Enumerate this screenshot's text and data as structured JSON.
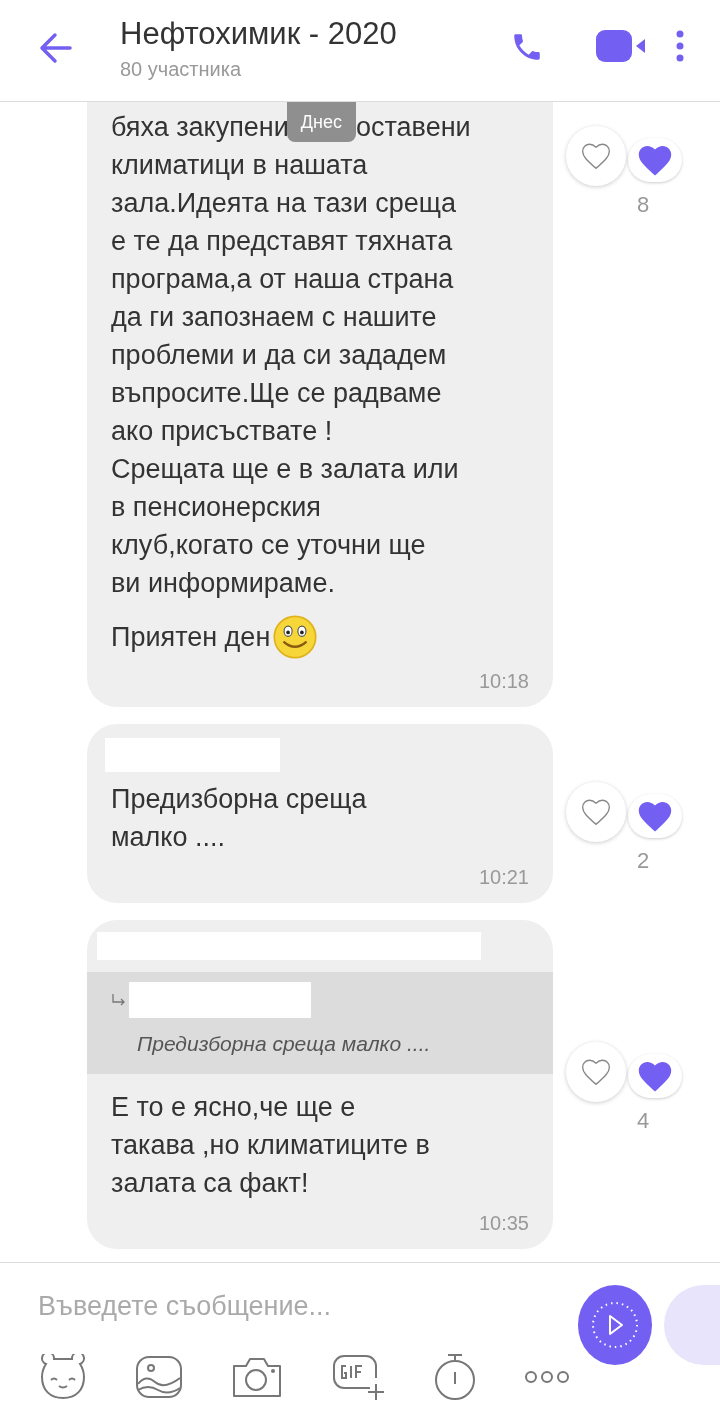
{
  "header": {
    "title": "Нефтохимик - 2020",
    "subtitle": "80 участника"
  },
  "date_badge": "Днес",
  "messages": [
    {
      "first_line": [
        "бяха закупени",
        "оставени"
      ],
      "text": "климатици в нашата\nзала.Идеята на тази среща\nе те да представят тяхната\nпрограма,а от наша страна\nда ги запознаем с нашите\nпроблеми и да си зададем\nвъпросите.Ще се радваме\nако присъствате !\nСрещата ще е в залата или\nв пенсионерския\nклуб,когато се уточни ще\nви информираме.",
      "closing": "Приятен ден",
      "time": "10:18",
      "reaction_count": "8"
    },
    {
      "sender_redacted": true,
      "text": "Предизборна среща\nмалко ....",
      "time": "10:21",
      "reaction_count": "2"
    },
    {
      "sender_redacted": true,
      "quote": {
        "author_redacted": true,
        "text": "Предизборна среща малко ...."
      },
      "text": "Е то е ясно,че ще е\nтакава ,но климатиците в\nзалата са факт!",
      "time": "10:35",
      "reaction_count": "4"
    }
  ],
  "composer": {
    "placeholder": "Въведете съобщение..."
  }
}
